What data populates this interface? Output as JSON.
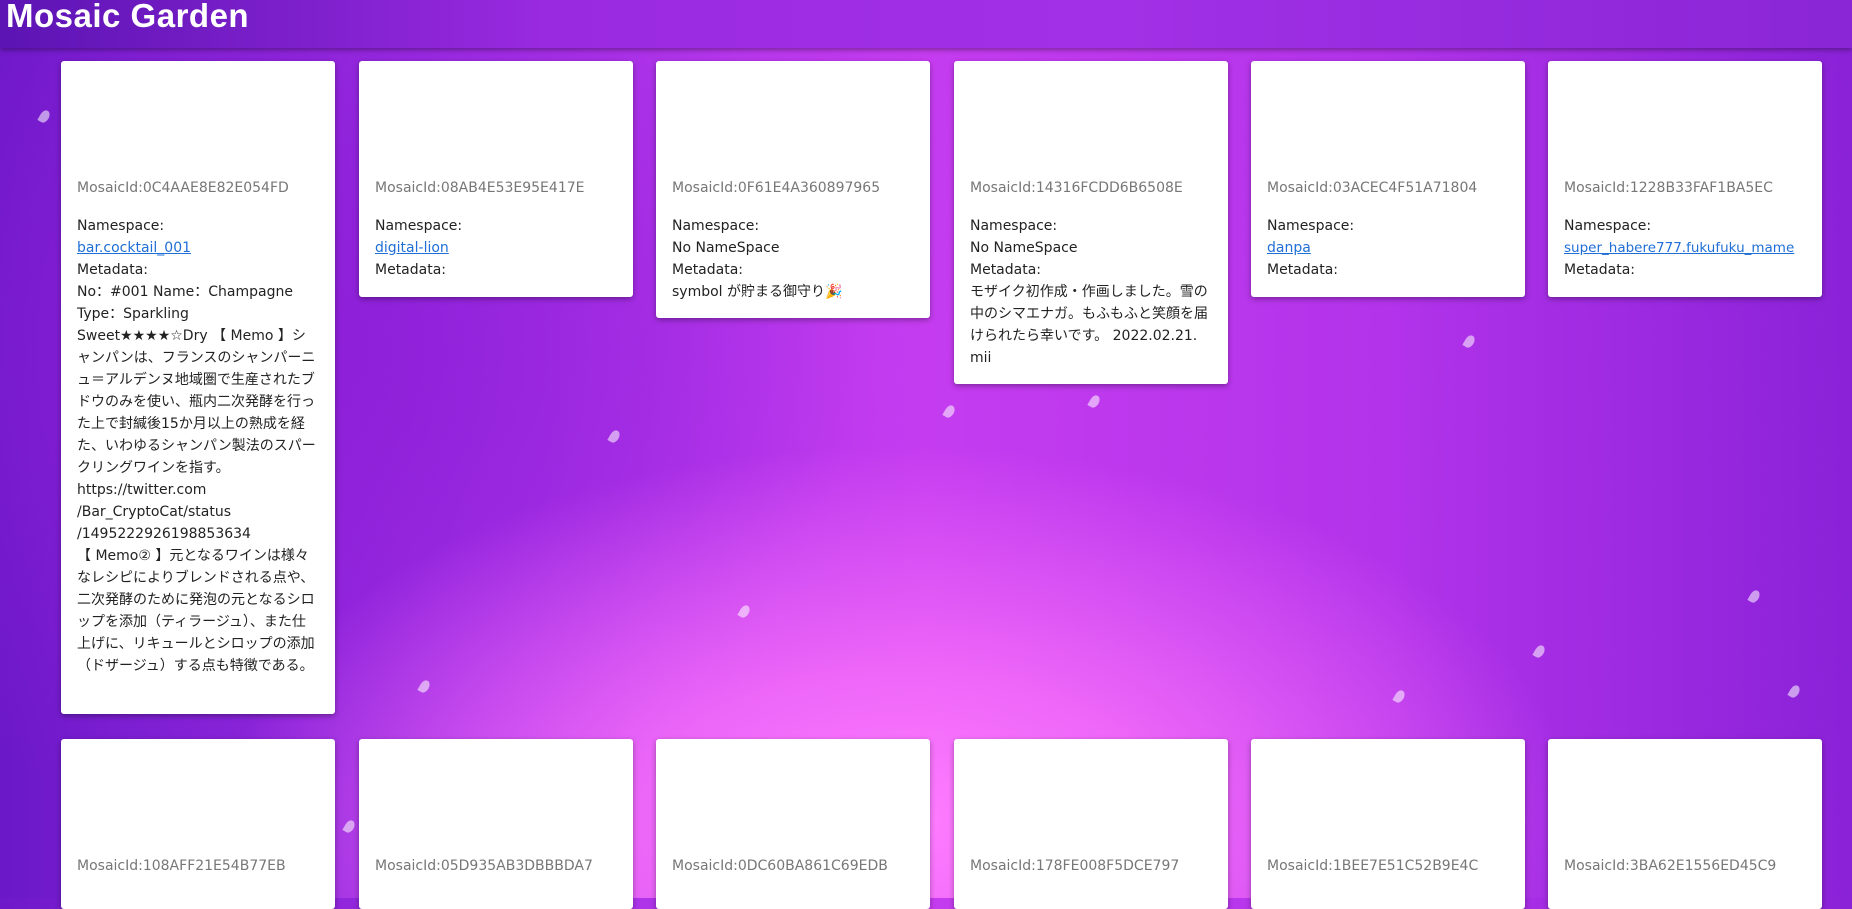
{
  "app": {
    "title": "Mosaic Garden"
  },
  "labels": {
    "namespace": "Namespace:",
    "metadata": "Metadata:"
  },
  "mosaics": [
    {
      "id": "MosaicId:0C4AAE8E82E054FD",
      "namespace": "bar.cocktail_001",
      "metadata": "No：#001 Name：Champagne\nType：Sparkling\nSweet★★★★☆Dry 【 Memo 】シャンパンは、フランスのシャンパーニュ＝アルデンヌ地域圏で生産されたブドウのみを使い、瓶内二次発酵を行った上で封緘後15か月以上の熟成を経た、いわゆるシャンパン製法のスパークリングワインを指す。\nhttps://twitter.com\n/Bar_CryptoCat/status\n/1495222926198853634\n【 Memo② 】元となるワインは様々なレシピによりブレンドされる点や、二次発酵のために発泡の元となるシロップを添加（ティラージュ）、また仕上げに、リキュールとシロップの添加（ドザージュ）する点も特徴である。"
    },
    {
      "id": "MosaicId:08AB4E53E95E417E",
      "namespace": "digital-lion",
      "metadata": ""
    },
    {
      "id": "MosaicId:0F61E4A360897965",
      "namespace": "No NameSpace",
      "metadata": "symbol が貯まる御守り🎉"
    },
    {
      "id": "MosaicId:14316FCDD6B6508E",
      "namespace": "No NameSpace",
      "metadata": "モザイク初作成・作画しました。雪の中のシマエナガ。もふもふと笑顔を届けられたら幸いです。 2022.02.21. mii"
    },
    {
      "id": "MosaicId:03ACEC4F51A71804",
      "namespace": "danpa",
      "metadata": ""
    },
    {
      "id": "MosaicId:1228B33FAF1BA5EC",
      "namespace": "super_habere777.fukufuku_mame",
      "metadata": ""
    },
    {
      "id": "MosaicId:108AFF21E54B77EB"
    },
    {
      "id": "MosaicId:05D935AB3DBBBDA7"
    },
    {
      "id": "MosaicId:0DC60BA861C69EDB"
    },
    {
      "id": "MosaicId:178FE008F5DCE797"
    },
    {
      "id": "MosaicId:1BEE7E51C52B9E4C"
    },
    {
      "id": "MosaicId:3BA62E1556ED45C9"
    }
  ]
}
